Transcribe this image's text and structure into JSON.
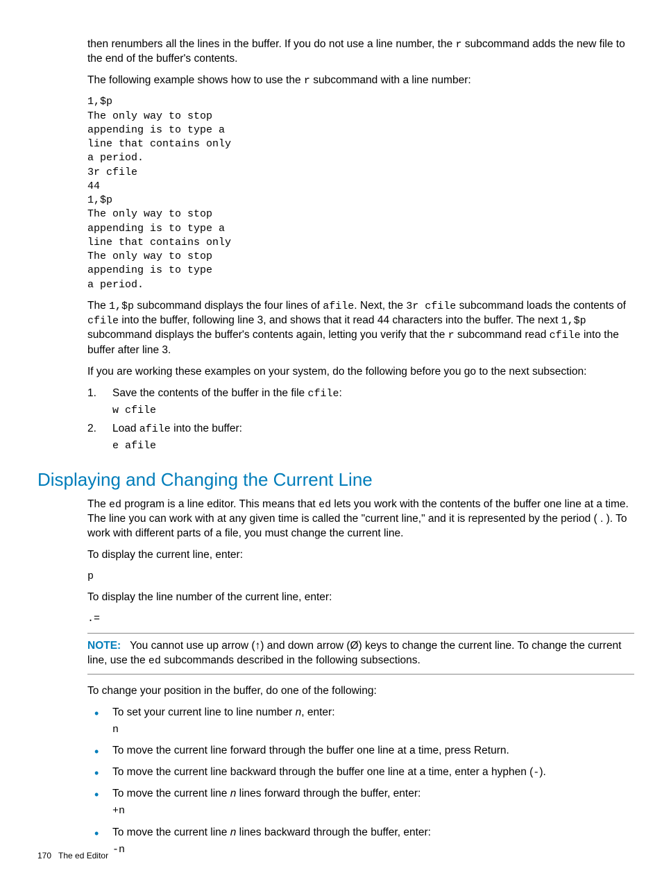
{
  "para1_a": "then renumbers all the lines in the buffer. If you do not use a line number, the ",
  "para1_b": "r",
  "para1_c": " subcommand adds the new file to the end of the buffer's contents.",
  "para2_a": "The following example shows how to use the ",
  "para2_b": "r",
  "para2_c": " subcommand with a line number:",
  "code1": "1,$p\nThe only way to stop\nappending is to type a\nline that contains only\na period.\n3r cfile\n44\n1,$p\nThe only way to stop\nappending is to type a\nline that contains only\nThe only way to stop\nappending is to type\na period.",
  "para3_a": "The ",
  "para3_b": "1,$p",
  "para3_c": " subcommand displays the four lines of ",
  "para3_d": "afile",
  "para3_e": ". Next, the ",
  "para3_f": "3r cfile",
  "para3_g": " subcommand loads the contents of ",
  "para3_h": "cfile",
  "para3_i": " into the buffer, following line 3, and shows that it read 44 characters into the buffer. The next ",
  "para3_j": "1,$p",
  "para3_k": " subcommand displays the buffer's contents again, letting you verify that the ",
  "para3_l": "r",
  "para3_m": " subcommand read ",
  "para3_n": "cfile",
  "para3_o": " into the buffer after line 3.",
  "para4": "If you are working these examples on your system, do the following before you go to the next subsection:",
  "step1_num": "1.",
  "step1_a": "Save the contents of the buffer in the file ",
  "step1_b": "cfile",
  "step1_c": ":",
  "step1_code": "w cfile",
  "step2_num": "2.",
  "step2_a": "Load ",
  "step2_b": "afile",
  "step2_c": " into the buffer:",
  "step2_code": "e afile",
  "section_heading": "Displaying and Changing the Current Line",
  "para5_a": "The ",
  "para5_b": "ed",
  "para5_c": " program is a line editor. This means that ",
  "para5_d": "ed",
  "para5_e": " lets you work with the contents of the buffer one line at a time. The line you can work with at any given time is called the \"current line,\" and it is represented by the period ( . ). To work with different parts of a file, you must change the current line.",
  "para6": "To display the current line, enter:",
  "code2": "p",
  "para7": "To display the line number of the current line, enter:",
  "code3": ".=",
  "note_label": "NOTE:",
  "note_a": "You cannot use up arrow (↑) and down arrow (Ø) keys to change the current line. To change the current line, use the ",
  "note_b": "ed",
  "note_c": " subcommands described in the following subsections.",
  "para8": "To change your position in the buffer, do one of the following:",
  "b1_a": "To set your current line to line number ",
  "b1_b": "n",
  "b1_c": ", enter:",
  "b1_code": "n",
  "b2": "To move the current line forward through the buffer one line at a time, press Return.",
  "b3_a": "To move the current line backward through the buffer one line at a time, enter a hyphen (",
  "b3_b": "-",
  "b3_c": ").",
  "b4_a": "To move the current line ",
  "b4_b": "n",
  "b4_c": " lines forward through the buffer, enter:",
  "b4_code": "+n",
  "b5_a": "To move the current line ",
  "b5_b": "n",
  "b5_c": " lines backward through the buffer, enter:",
  "b5_code": "-n",
  "footer_page": "170",
  "footer_title": "The ed Editor"
}
